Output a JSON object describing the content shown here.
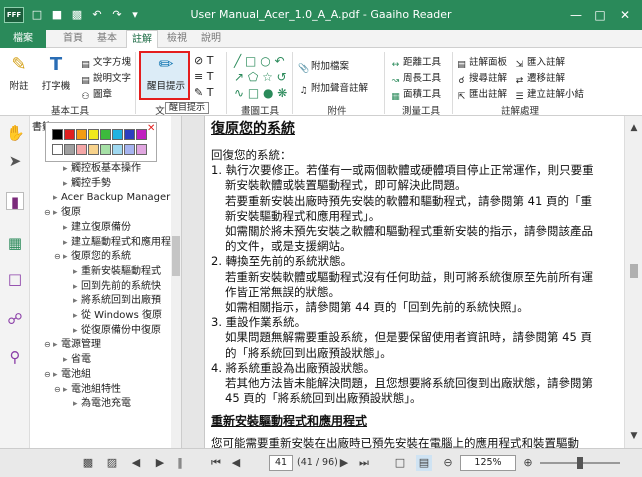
{
  "window": {
    "app_icon": "FFF",
    "title": "User Manual_Acer_1.0_A_A.pdf - Gaaiho Reader",
    "quick_access": [
      "folder-icon",
      "save-icon",
      "print-icon",
      "grid-icon",
      "undo-icon",
      "redo-icon",
      "dropdown-icon"
    ]
  },
  "tabs": [
    {
      "label": "檔案",
      "kind": "file"
    },
    {
      "label": "首頁",
      "kind": "normal"
    },
    {
      "label": "基本",
      "kind": "normal"
    },
    {
      "label": "註解",
      "kind": "active"
    },
    {
      "label": "檢視",
      "kind": "normal"
    },
    {
      "label": "說明",
      "kind": "normal"
    }
  ],
  "ribbon": {
    "basic_tools": {
      "group_label": "基本工具",
      "attach": "附註",
      "typewriter": "打字機",
      "text_box": "文字方塊",
      "callout": "說明文字",
      "stamp": "圖章"
    },
    "text_group": {
      "group_label": "文",
      "highlight": "醒目提示"
    },
    "drawing": {
      "group_label": "畫圖工具"
    },
    "attach": {
      "group_label": "附件",
      "attach_file": "附加檔案",
      "attach_sound": "附加聲音註解"
    },
    "measure": {
      "group_label": "測量工具",
      "distance": "距離工具",
      "perimeter": "周長工具",
      "area": "面積工具"
    },
    "comments": {
      "group_label": "註解處理",
      "panel": "註解面板",
      "search": "搜尋註解",
      "export": "匯出註解",
      "import": "匯入註解",
      "migrate": "遷移註解",
      "summary": "建立註解小結"
    }
  },
  "tooltip": "醒目提示",
  "panel": {
    "header": "書籤",
    "tree": [
      {
        "label": "觸控板基本操作",
        "level": 2,
        "toggle": ""
      },
      {
        "label": "觸控手勢",
        "level": 2,
        "toggle": ""
      },
      {
        "label": "Acer Backup Manager",
        "level": 1,
        "toggle": ""
      },
      {
        "label": "復原",
        "level": 1,
        "toggle": "⊖"
      },
      {
        "label": "建立復原備份",
        "level": 2,
        "toggle": ""
      },
      {
        "label": "建立驅動程式和應用程",
        "level": 2,
        "toggle": ""
      },
      {
        "label": "復原您的系統",
        "level": 2,
        "toggle": "⊖"
      },
      {
        "label": "重新安裝驅動程式",
        "level": 3,
        "toggle": ""
      },
      {
        "label": "回到先前的系統快",
        "level": 3,
        "toggle": ""
      },
      {
        "label": "將系統回到出廠預",
        "level": 3,
        "toggle": ""
      },
      {
        "label": "從 Windows 復原",
        "level": 3,
        "toggle": ""
      },
      {
        "label": "從復原備份中復原",
        "level": 3,
        "toggle": ""
      },
      {
        "label": "電源管理",
        "level": 1,
        "toggle": "⊖"
      },
      {
        "label": "省電",
        "level": 2,
        "toggle": ""
      },
      {
        "label": "電池組",
        "level": 1,
        "toggle": "⊖"
      },
      {
        "label": "電池組特性",
        "level": 2,
        "toggle": "⊖"
      },
      {
        "label": "為電池充電",
        "level": 3,
        "toggle": ""
      }
    ]
  },
  "palette": {
    "row1": [
      "#000000",
      "#e02020",
      "#f39c12",
      "#f1e91b",
      "#3cba3c",
      "#20b2e0",
      "#2c3fc0",
      "#c020c0"
    ],
    "row2": [
      "#ffffff",
      "#a0a0a0",
      "#f4a6a6",
      "#f7d28b",
      "#a6e0a6",
      "#9fd8f0",
      "#a6b4f0",
      "#e0a6e0"
    ]
  },
  "document": {
    "heading": "復原您的系統",
    "lines": [
      {
        "text": "回復您的系統：",
        "indent": 0
      },
      {
        "text": "1. 執行次要修正。若僅有一或兩個軟體或硬體項目停止正常運作，則只要重",
        "indent": 0
      },
      {
        "text": "新安裝軟體或裝置驅動程式，即可解決此問題。",
        "indent": 1
      },
      {
        "text": "若要重新安裝出廠時預先安裝的軟體和驅動程式，請參閱第 41 頁的「重",
        "indent": 1
      },
      {
        "text": "新安裝驅動程式和應用程式」。",
        "indent": 1
      },
      {
        "text": "如需關於將未預先安裝之軟體和驅動程式重新安裝的指示，請參閱該產品",
        "indent": 1
      },
      {
        "text": "的文件，或是支援網站。",
        "indent": 1
      },
      {
        "text": "2. 轉換至先前的系統狀態。",
        "indent": 0
      },
      {
        "text": "若重新安裝軟體或驅動程式沒有任何助益，則可將系統復原至先前所有運",
        "indent": 1
      },
      {
        "text": "作皆正常無誤的狀態。",
        "indent": 1
      },
      {
        "text": "如需相關指示，請參閱第 44 頁的「回到先前的系統快照」。",
        "indent": 1
      },
      {
        "text": "3. 重設作業系統。",
        "indent": 0
      },
      {
        "text": "如果問題無解需要重設系統，但是要保留使用者資訊時，請參閱第 45 頁",
        "indent": 1
      },
      {
        "text": "的「將系統回到出廠預設狀態」。",
        "indent": 1
      },
      {
        "text": "4. 將系統重設為出廠預設狀態。",
        "indent": 0
      },
      {
        "text": "若其他方法皆未能解決問題，且您想要將系統回復到出廠狀態，請參閱第",
        "indent": 1
      },
      {
        "text": "45 頁的「將系統回到出廠預設狀態」。",
        "indent": 1
      }
    ],
    "subheading": "重新安裝驅動程式和應用程式",
    "last_line": "您可能需要重新安裝在出廠時已預先安裝在電腦上的應用程式和裝置驅動"
  },
  "status": {
    "current_page": "41",
    "page_total": "(41 / 96)",
    "zoom": "125%",
    "zoom_fraction": 0.5
  }
}
